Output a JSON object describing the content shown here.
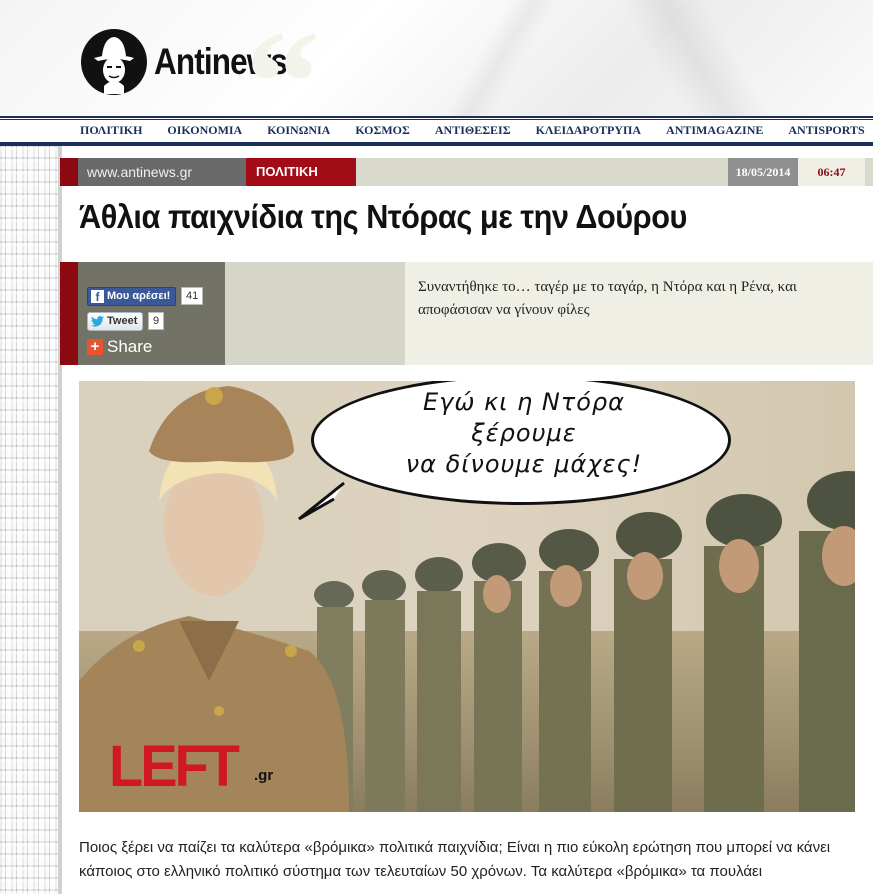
{
  "header": {
    "logo_text": "Antinews"
  },
  "nav": {
    "items": [
      "ΠΟΛΙΤΙΚΗ",
      "ΟΙΚΟΝΟΜΙΑ",
      "ΚΟΙΝΩΝΙΑ",
      "ΚΟΣΜΟΣ",
      "ΑΝΤΙΘΕΣΕΙΣ",
      "ΚΛΕΙΔΑΡΟΤΡΥΠΑ",
      "ANTIMAGAZINE",
      "ANTISPORTS"
    ]
  },
  "breadcrumb": {
    "site": "www.antinews.gr",
    "section": "ΠΟΛΙΤΙΚΗ",
    "date": "18/05/2014",
    "time": "06:47"
  },
  "article": {
    "title": "Άθλια παιχνίδια της Ντόρας με την Δούρου",
    "summary": "Συναντήθηκε το… ταγέρ με το ταγάρ, η Ντόρα και η Ρένα, και αποφάσισαν να γίνουν φίλες",
    "body": "Ποιος ξέρει να παίζει τα καλύτερα «βρόμικα» πολιτικά παιχνίδια; Είναι η πιο εύκολη ερώτηση που μπορεί να κάνει κάποιος στο ελληνικό πολιτικό σύστημα των τελευταίων 50 χρόνων. Τα καλύτερα «βρόμικα» τα πουλάει"
  },
  "social": {
    "facebook_label": "Μου αρέσει!",
    "facebook_count": "41",
    "tweet_label": "Tweet",
    "tweet_count": "9",
    "share_label": "Share"
  },
  "photo": {
    "speech_lines": [
      "Εγώ κι η Ντόρα",
      "ξέρουμε",
      "να δίνουμε μάχες!"
    ],
    "watermark": "LEFT",
    "watermark_suffix": ".gr"
  },
  "colors": {
    "brand_red": "#a10c16",
    "nav_blue": "#1a2f5a",
    "facebook_blue": "#3b5998"
  }
}
